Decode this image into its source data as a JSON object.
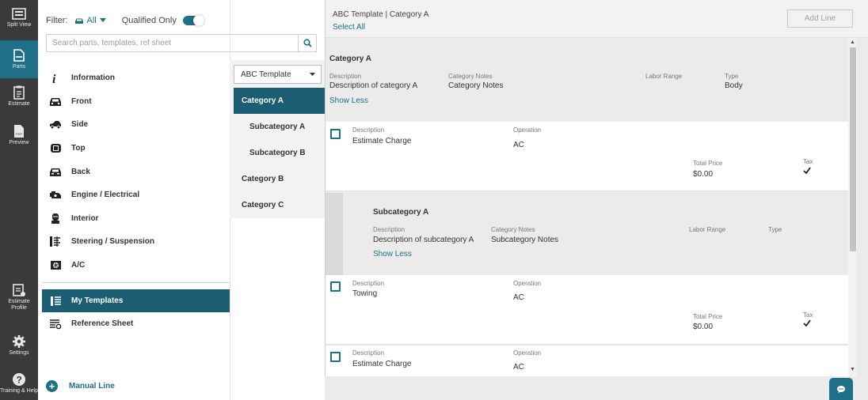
{
  "rail": {
    "items": [
      {
        "label": "Split View",
        "icon": "split-view-icon"
      },
      {
        "label": "Parts",
        "icon": "parts-icon"
      },
      {
        "label": "Estimate",
        "icon": "estimate-icon"
      },
      {
        "label": "Preview",
        "icon": "preview-icon"
      },
      {
        "label": "Estimate Profile",
        "icon": "estimate-profile-icon"
      },
      {
        "label": "Settings",
        "icon": "gear-icon"
      },
      {
        "label": "Training & Help",
        "icon": "help-icon"
      }
    ]
  },
  "filter": {
    "label": "Filter:",
    "value": "All",
    "qualified_label": "Qualified Only",
    "qualified_on": true
  },
  "search": {
    "placeholder": "Search parts, templates, ref sheet"
  },
  "categories": [
    {
      "label": "Information",
      "icon": "info-icon"
    },
    {
      "label": "Front",
      "icon": "car-front-icon"
    },
    {
      "label": "Side",
      "icon": "car-side-icon"
    },
    {
      "label": "Top",
      "icon": "car-top-icon"
    },
    {
      "label": "Back",
      "icon": "car-back-icon"
    },
    {
      "label": "Engine / Electrical",
      "icon": "engine-icon"
    },
    {
      "label": "Interior",
      "icon": "seat-icon"
    },
    {
      "label": "Steering / Suspension",
      "icon": "suspension-icon"
    },
    {
      "label": "A/C",
      "icon": "ac-icon"
    }
  ],
  "templates": {
    "my_templates": "My Templates",
    "reference_sheet": "Reference Sheet"
  },
  "manual_line": "Manual Line",
  "template_column": {
    "selected": "ABC Template",
    "items": [
      {
        "label": "Category A",
        "active": true,
        "sub": false
      },
      {
        "label": "Subcategory A",
        "active": false,
        "sub": true
      },
      {
        "label": "Subcategory B",
        "active": false,
        "sub": true
      },
      {
        "label": "Category B",
        "active": false,
        "sub": false
      },
      {
        "label": "Category C",
        "active": false,
        "sub": false
      }
    ]
  },
  "right": {
    "breadcrumb": "ABC Template | Category A",
    "select_all": "Select All",
    "add_line": "Add Line",
    "category": {
      "title": "Category A",
      "description_label": "Description",
      "description": "Description of category A",
      "notes_label": "Category Notes",
      "notes": "Category Notes",
      "labor_label": "Labor Range",
      "labor": "",
      "type_label": "Type",
      "type": "Body",
      "show_less": "Show Less"
    },
    "line1": {
      "description_label": "Description",
      "description": "Estimate Charge",
      "operation_label": "Operation",
      "operation": "AC",
      "total_label": "Total Price",
      "total": "$0.00",
      "tax_label": "Tax",
      "tax_checked": true
    },
    "subcategory": {
      "title": "Subcategory A",
      "description_label": "Description",
      "description": "Description of subcategory A",
      "notes_label": "Category Notes",
      "notes": "Subcategory Notes",
      "labor_label": "Labor Range",
      "type_label": "Type",
      "show_less": "Show Less"
    },
    "line2": {
      "description_label": "Description",
      "description": "Towing",
      "operation_label": "Operation",
      "operation": "AC",
      "total_label": "Total Price",
      "total": "$0.00",
      "tax_label": "Tax",
      "tax_checked": true
    },
    "line3": {
      "description_label": "Description",
      "description": "Estimate Charge",
      "operation_label": "Operation",
      "operation": "AC"
    }
  },
  "colors": {
    "accent": "#1e6f87",
    "rail": "#3a3a3a",
    "active_row": "#1b5e73"
  }
}
